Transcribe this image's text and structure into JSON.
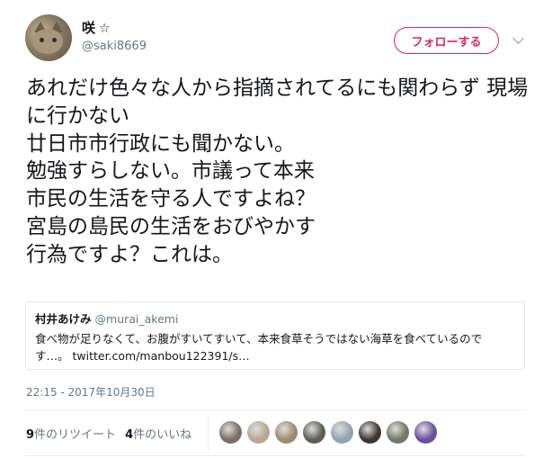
{
  "user": {
    "name": "咲",
    "name_symbol": "☆",
    "handle": "@saki8669"
  },
  "follow_button": {
    "label": "フォローする"
  },
  "tweet": {
    "text": "あれだけ色々な人から指摘されてるにも関わらず 現場に行かない\n廿日市市行政にも聞かない。\n勉強すらしない。市議って本来\n市民の生活を守る人ですよね？\n宮島の島民の生活をおびやかす\n行為ですよ？これは。"
  },
  "quoted": {
    "name": "村井あけみ",
    "handle": "@murai_akemi",
    "text": "食べ物が足りなくて、お腹がすいてすいて、本来食草そうではない海草を食べているのです…。 twitter.com/manbou122391/s…"
  },
  "timestamp": "22:15 - 2017年10月30日",
  "stats": {
    "retweets_count": "9",
    "retweets_label": "件のリツイート",
    "likes_count": "4",
    "likes_label": "件のいいね"
  },
  "colors": {
    "accent": "#e0245e",
    "secondary_text": "#657786",
    "border": "#e1e8ed"
  },
  "likers": [
    {
      "icon": "liker-avatar",
      "color": "#7b6f63"
    },
    {
      "icon": "liker-avatar",
      "color": "#b8a890"
    },
    {
      "icon": "liker-avatar",
      "color": "#9c8c6d"
    },
    {
      "icon": "liker-avatar",
      "color": "#5b5f57"
    },
    {
      "icon": "liker-avatar",
      "color": "#8fa4b4"
    },
    {
      "icon": "liker-avatar",
      "color": "#3c3530"
    },
    {
      "icon": "liker-avatar",
      "color": "#6f7a62"
    },
    {
      "icon": "liker-avatar",
      "color": "#6a4fa0"
    }
  ]
}
